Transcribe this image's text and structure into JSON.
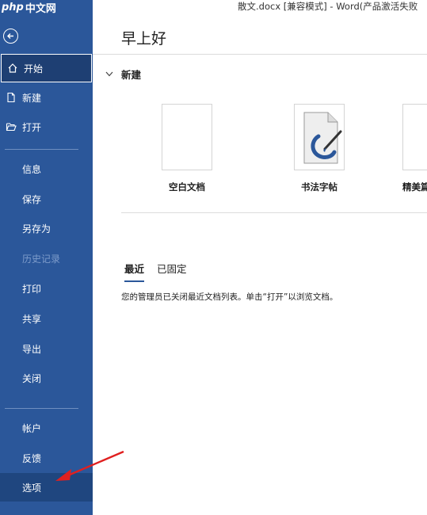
{
  "title_bar": {
    "text": "散文.docx [兼容模式]  -  Word(产品激活失败"
  },
  "brand": {
    "php": "php",
    "cn": "中文网"
  },
  "sidebar": {
    "items": [
      {
        "label": "开始",
        "icon": "home-icon",
        "active": true
      },
      {
        "label": "新建",
        "icon": "new-document-icon"
      },
      {
        "label": "打开",
        "icon": "open-folder-icon"
      },
      {
        "label": "信息"
      },
      {
        "label": "保存"
      },
      {
        "label": "另存为"
      },
      {
        "label": "历史记录",
        "disabled": true
      },
      {
        "label": "打印"
      },
      {
        "label": "共享"
      },
      {
        "label": "导出"
      },
      {
        "label": "关闭"
      },
      {
        "label": "帐户"
      },
      {
        "label": "反馈"
      },
      {
        "label": "选项"
      }
    ]
  },
  "main": {
    "greeting": "早上好",
    "new_section": {
      "title": "新建",
      "templates": [
        {
          "label": "空白文档"
        },
        {
          "label": "书法字帖"
        },
        {
          "label": "精美篇"
        }
      ]
    },
    "tabs": [
      {
        "label": "最近",
        "active": true
      },
      {
        "label": "已固定"
      }
    ],
    "notice": "您的管理员已关闭最近文档列表。单击“打开”以浏览文档。"
  },
  "colors": {
    "sidebar": "#2b579a",
    "arrow": "#e02020"
  }
}
